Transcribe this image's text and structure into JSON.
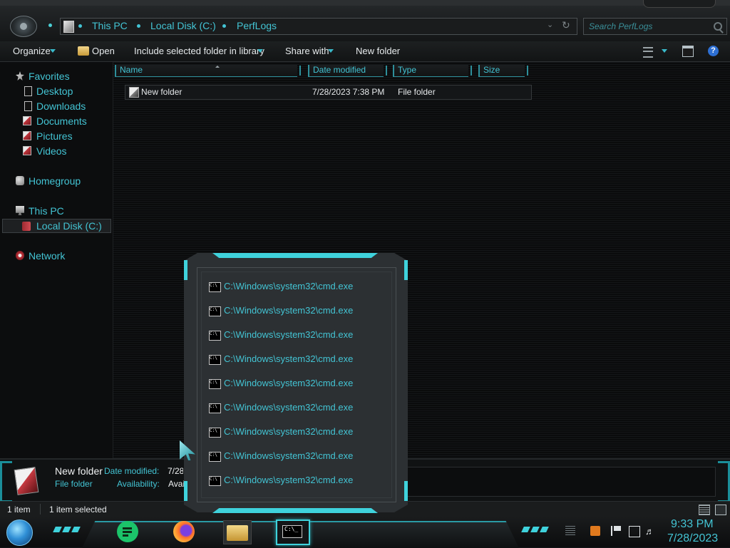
{
  "address": {
    "crumbs": [
      "This PC",
      "Local Disk (C:)",
      "PerfLogs"
    ]
  },
  "search": {
    "placeholder": "Search PerfLogs"
  },
  "toolbar": {
    "organize": "Organize",
    "open": "Open",
    "include": "Include selected folder in library",
    "share": "Share with",
    "new_folder": "New folder"
  },
  "nav": {
    "favorites": "Favorites",
    "desktop": "Desktop",
    "downloads": "Downloads",
    "documents": "Documents",
    "pictures": "Pictures",
    "videos": "Videos",
    "homegroup": "Homegroup",
    "this_pc": "This PC",
    "local_disk": "Local Disk (C:)",
    "network": "Network"
  },
  "columns": {
    "name": "Name",
    "date": "Date modified",
    "type": "Type",
    "size": "Size"
  },
  "files": [
    {
      "name": "New folder",
      "date": "7/28/2023 7:38 PM",
      "type": "File folder",
      "size": ""
    }
  ],
  "details": {
    "name": "New folder",
    "type": "File folder",
    "date_label": "Date modified:",
    "date_value": "7/28/2023 7:38 PM",
    "avail_label": "Availability:",
    "avail_value": "Available offline"
  },
  "status": {
    "count": "1 item",
    "selected": "1 item selected"
  },
  "jumplist": {
    "items": [
      "C:\\Windows\\system32\\cmd.exe",
      "C:\\Windows\\system32\\cmd.exe",
      "C:\\Windows\\system32\\cmd.exe",
      "C:\\Windows\\system32\\cmd.exe",
      "C:\\Windows\\system32\\cmd.exe",
      "C:\\Windows\\system32\\cmd.exe",
      "C:\\Windows\\system32\\cmd.exe",
      "C:\\Windows\\system32\\cmd.exe",
      "C:\\Windows\\system32\\cmd.exe"
    ]
  },
  "clock": {
    "time": "9:33 PM",
    "date": "7/28/2023"
  },
  "colors": {
    "accent": "#43c4d4",
    "glow": "#3fd2dc",
    "background": "#0b0c0d"
  }
}
